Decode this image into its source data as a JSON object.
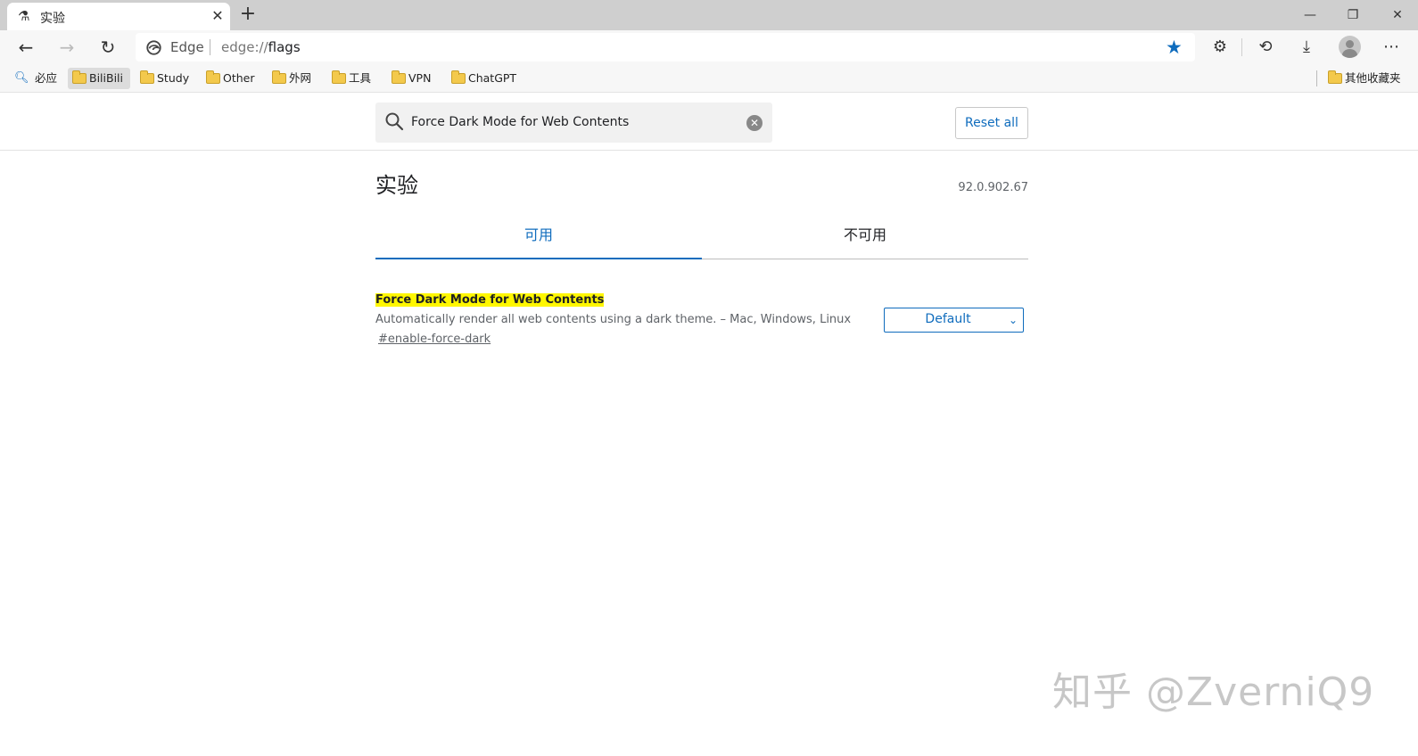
{
  "browser": {
    "tab": {
      "title": "实验",
      "close": "✕"
    },
    "new_tab": "+",
    "window": {
      "minimize": "—",
      "restore": "❐",
      "close": "✕"
    },
    "omnibox": {
      "brand": "Edge",
      "url_prefix": "edge://",
      "url_host": "flags"
    },
    "nav": {
      "back": "←",
      "forward": "→",
      "refresh": "↻"
    },
    "tools": {
      "extensions": "⚙",
      "history": "⟲",
      "downloads": "⤓",
      "more": "⋯"
    }
  },
  "bookmarks": {
    "search_label": "必应",
    "items": [
      {
        "label": "BiliBili"
      },
      {
        "label": "Study"
      },
      {
        "label": "Other"
      },
      {
        "label": "外网"
      },
      {
        "label": "工具"
      },
      {
        "label": "VPN"
      },
      {
        "label": "ChatGPT"
      }
    ],
    "other": "其他收藏夹"
  },
  "flags": {
    "search_value": "Force Dark Mode for Web Contents",
    "reset_label": "Reset all",
    "page_title": "实验",
    "version": "92.0.902.67",
    "tabs": [
      {
        "label": "可用"
      },
      {
        "label": "不可用"
      }
    ],
    "entry": {
      "name": "Force Dark Mode for Web Contents",
      "description": "Automatically render all web contents using a dark theme. – Mac, Windows, Linux",
      "link": "#enable-force-dark",
      "selected_value": "Default"
    }
  },
  "watermark": "知乎 @ZverniQ9",
  "colors": {
    "accent": "#0f6cbd",
    "highlight": "#fff700"
  }
}
